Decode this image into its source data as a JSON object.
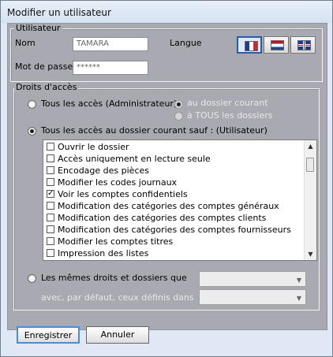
{
  "window": {
    "title": "Modifier un utilisateur"
  },
  "user_group": {
    "legend": "Utilisateur",
    "name_label": "Nom",
    "name_value": "TAMARA",
    "password_label": "Mot de passe",
    "password_value": "******",
    "language_label": "Langue"
  },
  "language_flags": [
    {
      "name": "French",
      "colors": [
        "#1f3a93",
        "#ffffff",
        "#d5262c"
      ]
    },
    {
      "name": "Dutch",
      "colors": [
        "#ae1c28",
        "#ffffff",
        "#21468b"
      ]
    },
    {
      "name": "English",
      "colors": [
        "#1f3a93",
        "#ffffff",
        "#c8102e"
      ]
    }
  ],
  "access": {
    "legend": "Droits d'accès",
    "all_access_label": "Tous les accès (Administrateur)",
    "current_folder_label": "au dossier courant",
    "all_folders_label": "à TOUS les dossiers",
    "exclusions_label": "Tous les accès au dossier courant sauf : (Utilisateur)",
    "items": [
      {
        "label": "Ouvrir le dossier",
        "checked": false
      },
      {
        "label": "Accès uniquement en lecture seule",
        "checked": false
      },
      {
        "label": "Encodage des pièces",
        "checked": false
      },
      {
        "label": "Modifier les codes journaux",
        "checked": false
      },
      {
        "label": "Voir les comptes confidentiels",
        "checked": true
      },
      {
        "label": "Modification des catégories des comptes généraux",
        "checked": false
      },
      {
        "label": "Modification des catégories des comptes clients",
        "checked": false
      },
      {
        "label": "Modification des catégories des comptes fournisseurs",
        "checked": false
      },
      {
        "label": "Modifier les comptes titres",
        "checked": false
      },
      {
        "label": "Impression des listes",
        "checked": false
      }
    ],
    "same_rights_label": "Les mêmes droits et dossiers que",
    "default_label": "avec, par défaut, ceux définis dans"
  },
  "buttons": {
    "save": "Enregistrer",
    "cancel": "Annuler"
  }
}
